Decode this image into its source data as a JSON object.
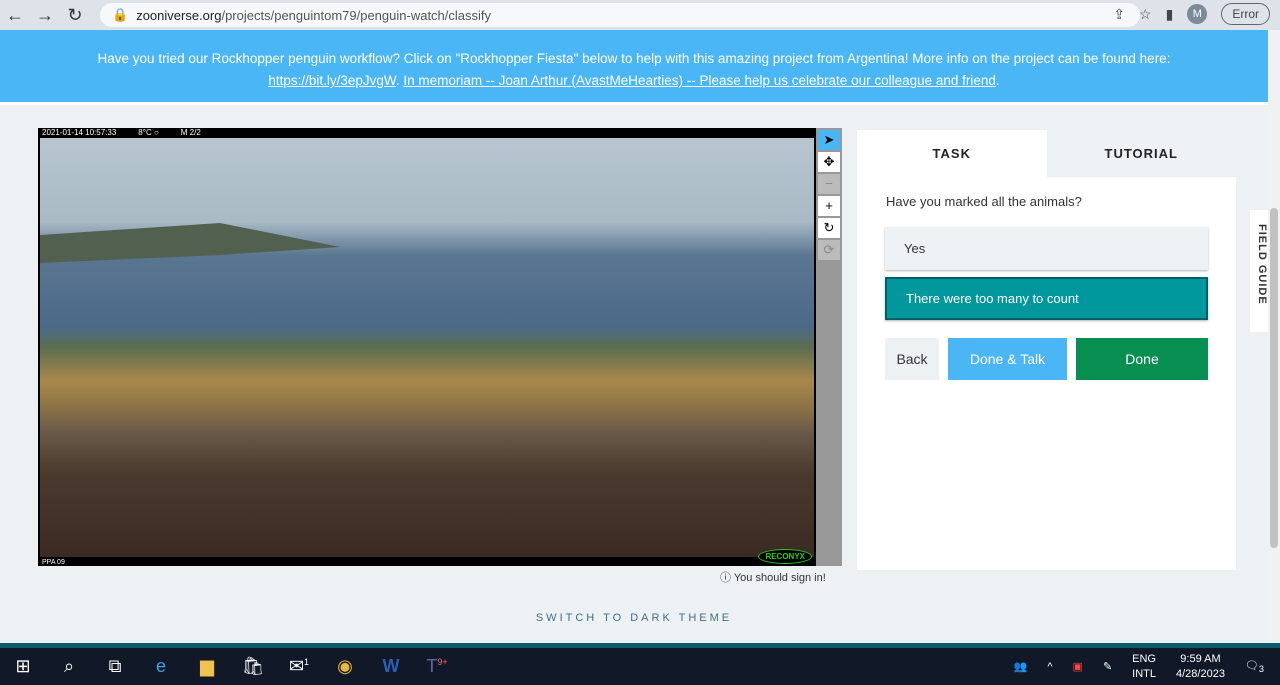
{
  "browser": {
    "url_domain": "zooniverse.org",
    "url_path": "/projects/penguintom79/penguin-watch/classify",
    "profile_initial": "M",
    "error_label": "Error"
  },
  "banner": {
    "text": "Have you tried our Rockhopper penguin workflow? Click on \"Rockhopper Fiesta\" below to help with this amazing project from Argentina! More info on the project can be found here:",
    "link1": "https://bit.ly/3epJvgW",
    "sep": ". ",
    "link2": "In memoriam -- Joan Arthur (AvastMeHearties) -- Please help us celebrate our colleague and friend",
    "end": "."
  },
  "camera": {
    "timestamp": "2021-01-14 10:57:33",
    "temp": "8°C ○",
    "mode": "M 2/2",
    "site": "PPA 09",
    "brand": "RECONYX"
  },
  "tools": [
    "pointer",
    "pan",
    "zoom-out",
    "zoom-in",
    "rotate",
    "reset"
  ],
  "sign_in": "You should sign in!",
  "panel": {
    "tabs": [
      "TASK",
      "TUTORIAL"
    ],
    "question": "Have you marked all the animals?",
    "answers": [
      "Yes",
      "There were too many to count"
    ],
    "back": "Back",
    "done_talk": "Done & Talk",
    "done": "Done",
    "field_guide": "FIELD GUIDE",
    "colors": {
      "teal": "#00979d",
      "blue": "#4ab6f5",
      "green": "#078f52"
    }
  },
  "theme_toggle": "SWITCH TO DARK THEME",
  "taskbar": {
    "lang1": "ENG",
    "lang2": "INTL",
    "time": "9:59 AM",
    "date": "4/28/2023",
    "mail_badge": "1",
    "teams_badge": "9+",
    "notif": "3"
  }
}
